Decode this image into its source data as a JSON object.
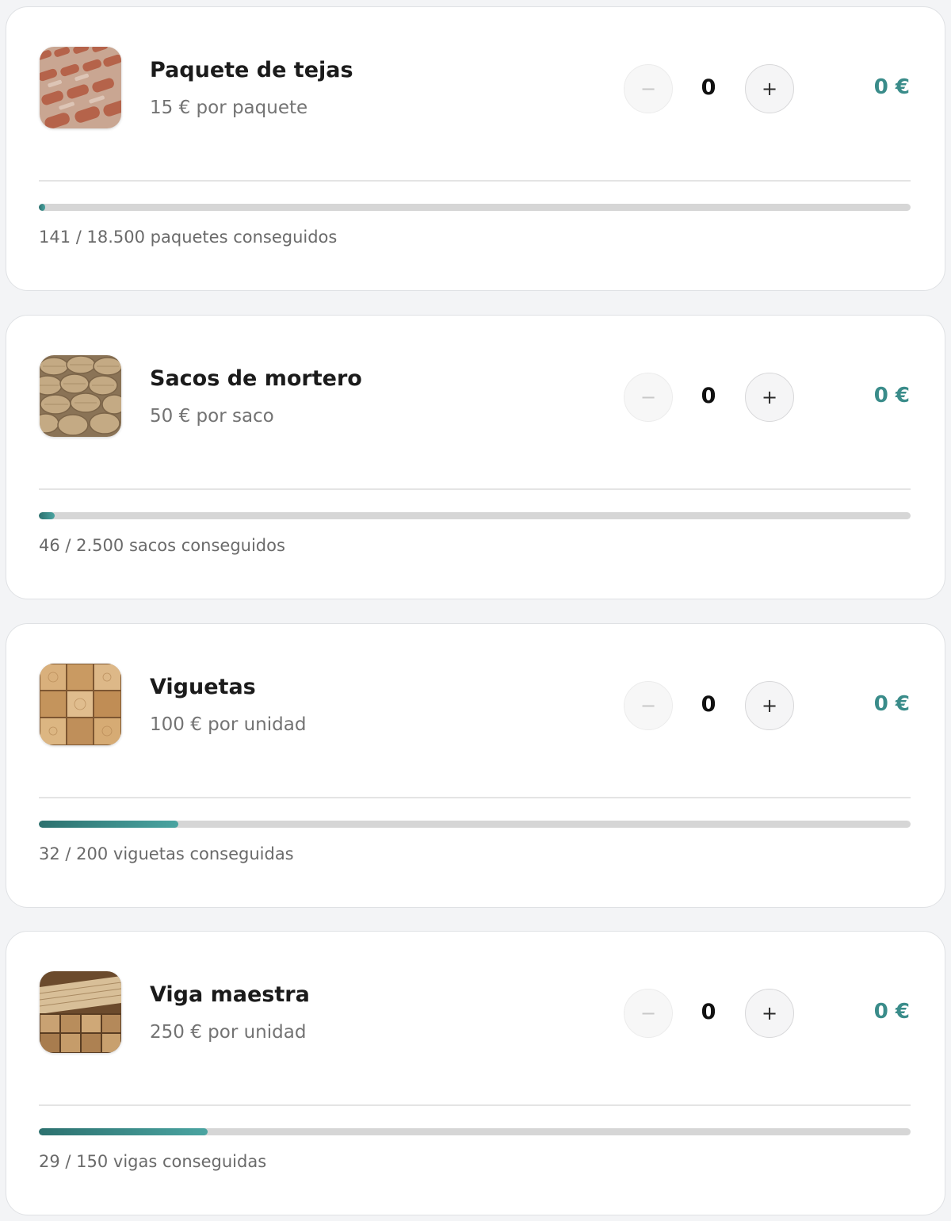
{
  "items": [
    {
      "title": "Paquete de tejas",
      "price": "15 € por paquete",
      "minus_icon": "−",
      "quantity": "0",
      "plus_icon": "+",
      "total": "0 €",
      "progress_fraction": 0.0076,
      "progress_label": "141 / 18.500 paquetes conseguidos",
      "image_icon": "roof-tiles-image"
    },
    {
      "title": "Sacos de mortero",
      "price": "50 € por saco",
      "minus_icon": "−",
      "quantity": "0",
      "plus_icon": "+",
      "total": "0 €",
      "progress_fraction": 0.0184,
      "progress_label": "46 / 2.500 sacos conseguidos",
      "image_icon": "mortar-sacks-image"
    },
    {
      "title": "Viguetas",
      "price": "100 € por unidad",
      "minus_icon": "−",
      "quantity": "0",
      "plus_icon": "+",
      "total": "0 €",
      "progress_fraction": 0.16,
      "progress_label": "32 / 200 viguetas conseguidas",
      "image_icon": "wood-joists-image"
    },
    {
      "title": "Viga maestra",
      "price": "250 € por unidad",
      "minus_icon": "−",
      "quantity": "0",
      "plus_icon": "+",
      "total": "0 €",
      "progress_fraction": 0.1933,
      "progress_label": "29 / 150 vigas conseguidas",
      "image_icon": "main-beam-image"
    }
  ],
  "colors": {
    "accent": "#3a8c8a",
    "progress_start": "#2c716f",
    "progress_end": "#4aa4a1",
    "track": "#d6d6d6",
    "page_background": "#f3f4f6"
  }
}
